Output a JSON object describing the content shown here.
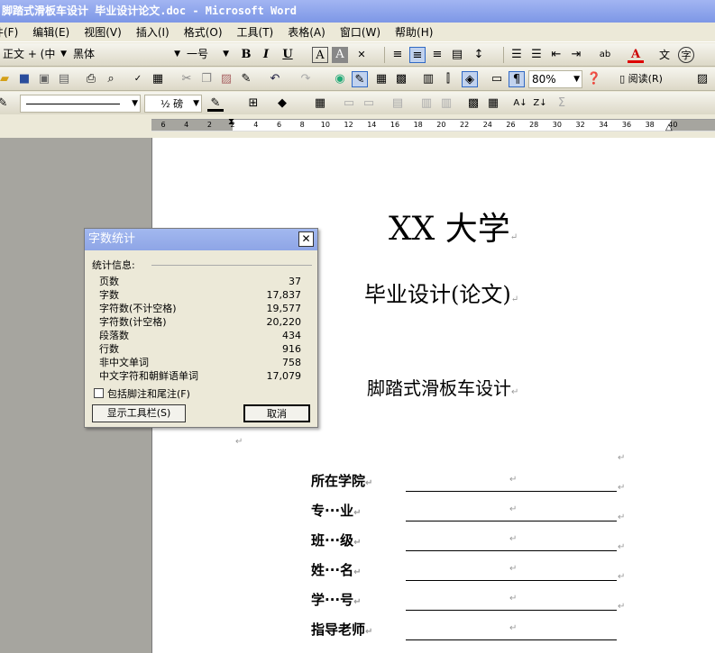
{
  "window_title": "脚踏式滑板车设计 毕业设计论文.doc - Microsoft Word",
  "menu": [
    "文件(F)",
    "编辑(E)",
    "视图(V)",
    "插入(I)",
    "格式(O)",
    "工具(T)",
    "表格(A)",
    "窗口(W)",
    "帮助(H)"
  ],
  "format_toolbar": {
    "style": "正文 + (中",
    "font": "黑体",
    "size": "一号"
  },
  "standard_toolbar": {
    "zoom": "80%",
    "read_label": "阅读(R)"
  },
  "drawing_toolbar": {
    "line_weight": "½ 磅"
  },
  "ruler_ticks": [
    "6",
    "4",
    "2",
    "2",
    "4",
    "6",
    "8",
    "10",
    "12",
    "14",
    "16",
    "18",
    "20",
    "22",
    "24",
    "26",
    "28",
    "30",
    "32",
    "34",
    "36",
    "38",
    "40"
  ],
  "document": {
    "university": "XX 大学",
    "subtitle": "毕业设计(论文)",
    "project_title": "脚踏式滑板车设计",
    "paragraph_mark": "↵",
    "fields": [
      {
        "label": "所在学院"
      },
      {
        "label": "专···业"
      },
      {
        "label": "班···级"
      },
      {
        "label": "姓···名"
      },
      {
        "label": "学···号"
      },
      {
        "label": "指导老师"
      }
    ]
  },
  "dialog": {
    "title": "字数统计",
    "group_label": "统计信息:",
    "stats": [
      {
        "label": "页数",
        "value": "37"
      },
      {
        "label": "字数",
        "value": "17,837"
      },
      {
        "label": "字符数(不计空格)",
        "value": "19,577"
      },
      {
        "label": "字符数(计空格)",
        "value": "20,220"
      },
      {
        "label": "段落数",
        "value": "434"
      },
      {
        "label": "行数",
        "value": "916"
      },
      {
        "label": "非中文单词",
        "value": "758"
      },
      {
        "label": "中文字符和朝鲜语单词",
        "value": "17,079"
      }
    ],
    "include_footnotes_label": "包括脚注和尾注(F)",
    "show_toolbar_button": "显示工具栏(S)",
    "cancel_button": "取消"
  }
}
